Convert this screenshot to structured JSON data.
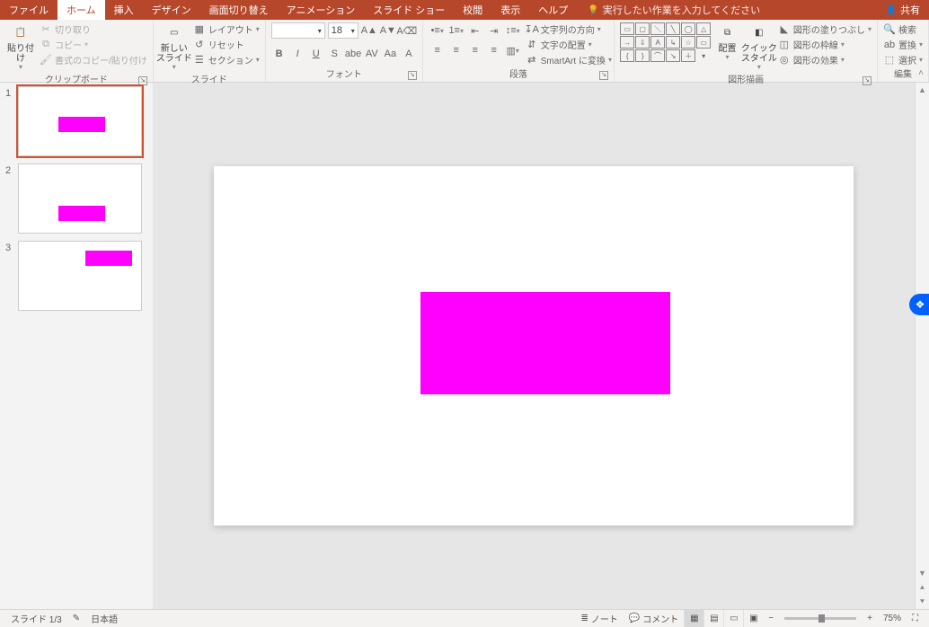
{
  "titlebar": {
    "tabs": [
      "ファイル",
      "ホーム",
      "挿入",
      "デザイン",
      "画面切り替え",
      "アニメーション",
      "スライド ショー",
      "校閲",
      "表示",
      "ヘルプ"
    ],
    "active_tab_index": 1,
    "search_placeholder": "実行したい作業を入力してください",
    "share": "共有"
  },
  "ribbon": {
    "clipboard": {
      "label": "クリップボード",
      "paste": "貼り付け",
      "cut": "切り取り",
      "copy": "コピー",
      "format_painter": "書式のコピー/貼り付け"
    },
    "slides": {
      "label": "スライド",
      "new_slide": "新しい\nスライド",
      "layout": "レイアウト",
      "reset": "リセット",
      "section": "セクション"
    },
    "font": {
      "label": "フォント",
      "size": "18",
      "row2": [
        "B",
        "I",
        "U",
        "S",
        "abe",
        "AV",
        "Aa",
        "A"
      ]
    },
    "paragraph": {
      "label": "段落",
      "text_direction": "文字列の方向",
      "align_text": "文字の配置",
      "smartart": "SmartArt に変換"
    },
    "drawing": {
      "label": "図形描画",
      "arrange": "配置",
      "quick_style": "クイック\nスタイル",
      "shape_fill": "図形の塗りつぶし",
      "shape_outline": "図形の枠線",
      "shape_effects": "図形の効果"
    },
    "editing": {
      "label": "編集",
      "find": "検索",
      "replace": "置換",
      "select": "選択"
    }
  },
  "thumbnails": [
    {
      "num": "1",
      "selected": true,
      "rect": {
        "l": 44,
        "t": 33,
        "w": 52,
        "h": 17
      }
    },
    {
      "num": "2",
      "selected": false,
      "rect": {
        "l": 44,
        "t": 46,
        "w": 52,
        "h": 17
      }
    },
    {
      "num": "3",
      "selected": false,
      "rect": {
        "l": 74,
        "t": 10,
        "w": 52,
        "h": 17
      }
    }
  ],
  "status": {
    "slide_counter": "スライド 1/3",
    "language": "日本語",
    "notes": "ノート",
    "comments": "コメント",
    "zoom": "75%"
  }
}
